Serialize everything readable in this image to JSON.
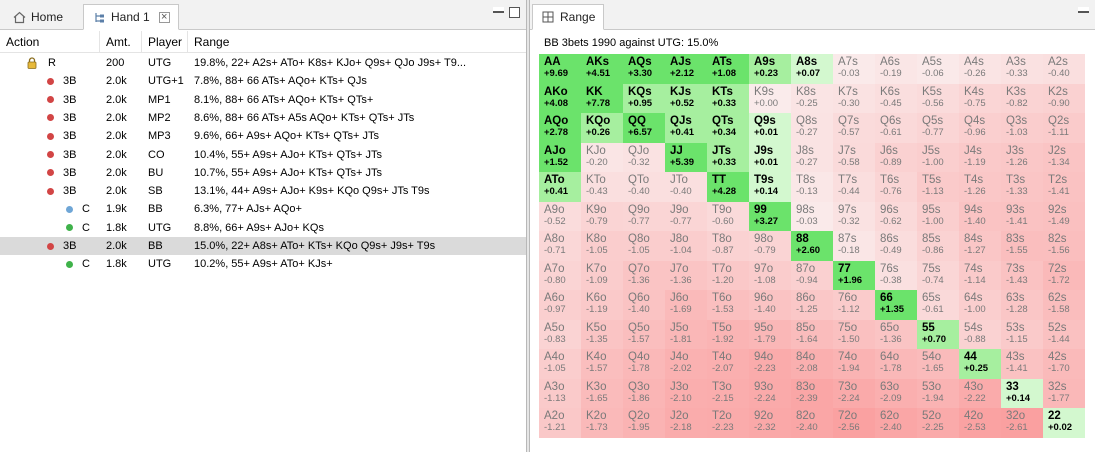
{
  "left": {
    "tabs": [
      {
        "label": "Home"
      },
      {
        "label": "Hand 1"
      }
    ],
    "columns": [
      "Action",
      "Amt.",
      "Player",
      "Range"
    ],
    "rows": [
      {
        "action": "R",
        "amt": "200",
        "player": "UTG",
        "range": "19.8%, 22+ A2s+ ATo+ K8s+ KJo+ Q9s+ QJo J9s+ T9...",
        "dot": "lock",
        "indent": 0
      },
      {
        "action": "3B",
        "amt": "2.0k",
        "player": "UTG+1",
        "range": "7.8%, 88+ 66 ATs+ AQo+ KTs+ QJs",
        "dot": "red",
        "indent": 1
      },
      {
        "action": "3B",
        "amt": "2.0k",
        "player": "MP1",
        "range": "8.1%, 88+ 66 ATs+ AQo+ KTs+ QTs+",
        "dot": "red",
        "indent": 1
      },
      {
        "action": "3B",
        "amt": "2.0k",
        "player": "MP2",
        "range": "8.6%, 88+ 66 ATs+ A5s AQo+ KTs+ QTs+ JTs",
        "dot": "red",
        "indent": 1
      },
      {
        "action": "3B",
        "amt": "2.0k",
        "player": "MP3",
        "range": "9.6%, 66+ A9s+ AQo+ KTs+ QTs+ JTs",
        "dot": "red",
        "indent": 1
      },
      {
        "action": "3B",
        "amt": "2.0k",
        "player": "CO",
        "range": "10.4%, 55+ A9s+ AJo+ KTs+ QTs+ JTs",
        "dot": "red",
        "indent": 1
      },
      {
        "action": "3B",
        "amt": "2.0k",
        "player": "BU",
        "range": "10.7%, 55+ A9s+ AJo+ KTs+ QTs+ JTs",
        "dot": "red",
        "indent": 1
      },
      {
        "action": "3B",
        "amt": "2.0k",
        "player": "SB",
        "range": "13.1%, 44+ A9s+ AJo+ K9s+ KQo Q9s+ JTs T9s",
        "dot": "red",
        "indent": 1
      },
      {
        "action": "C",
        "amt": "1.9k",
        "player": "BB",
        "range": "6.3%, 77+ AJs+ AQo+",
        "dot": "blue",
        "indent": 2
      },
      {
        "action": "C",
        "amt": "1.8k",
        "player": "UTG",
        "range": "8.8%, 66+ A9s+ AJo+ KQs",
        "dot": "green",
        "indent": 2
      },
      {
        "action": "3B",
        "amt": "2.0k",
        "player": "BB",
        "range": "15.0%, 22+ A8s+ ATo+ KTs+ KQo Q9s+ J9s+ T9s",
        "dot": "red",
        "indent": 1
      },
      {
        "action": "C",
        "amt": "1.8k",
        "player": "UTG",
        "range": "10.2%, 55+ A9s+ ATo+ KJs+",
        "dot": "green",
        "indent": 2
      }
    ]
  },
  "right": {
    "tab": "Range",
    "title": "BB 3bets 1990 against UTG: 15.0%",
    "colors": {
      "green_strong": "#6be36b",
      "green_light": "#c8f5c8",
      "white": "#ffffff",
      "red": "#f5b5b5"
    },
    "matrix": [
      [
        [
          "AA",
          "+9.69"
        ],
        [
          "AKs",
          "+4.51"
        ],
        [
          "AQs",
          "+3.30"
        ],
        [
          "AJs",
          "+2.12"
        ],
        [
          "ATs",
          "+1.08"
        ],
        [
          "A9s",
          "+0.23"
        ],
        [
          "A8s",
          "+0.07"
        ],
        [
          "A7s",
          "-0.03"
        ],
        [
          "A6s",
          "-0.19"
        ],
        [
          "A5s",
          "-0.06"
        ],
        [
          "A4s",
          "-0.26"
        ],
        [
          "A3s",
          "-0.33"
        ],
        [
          "A2s",
          "-0.40"
        ]
      ],
      [
        [
          "AKo",
          "+4.08"
        ],
        [
          "KK",
          "+7.78"
        ],
        [
          "KQs",
          "+0.95"
        ],
        [
          "KJs",
          "+0.52"
        ],
        [
          "KTs",
          "+0.33"
        ],
        [
          "K9s",
          "+0.00"
        ],
        [
          "K8s",
          "-0.25"
        ],
        [
          "K7s",
          "-0.30"
        ],
        [
          "K6s",
          "-0.45"
        ],
        [
          "K5s",
          "-0.56"
        ],
        [
          "K4s",
          "-0.75"
        ],
        [
          "K3s",
          "-0.82"
        ],
        [
          "K2s",
          "-0.90"
        ]
      ],
      [
        [
          "AQo",
          "+2.78"
        ],
        [
          "KQo",
          "+0.26"
        ],
        [
          "QQ",
          "+6.57"
        ],
        [
          "QJs",
          "+0.41"
        ],
        [
          "QTs",
          "+0.34"
        ],
        [
          "Q9s",
          "+0.01"
        ],
        [
          "Q8s",
          "-0.27"
        ],
        [
          "Q7s",
          "-0.57"
        ],
        [
          "Q6s",
          "-0.61"
        ],
        [
          "Q5s",
          "-0.77"
        ],
        [
          "Q4s",
          "-0.96"
        ],
        [
          "Q3s",
          "-1.03"
        ],
        [
          "Q2s",
          "-1.11"
        ]
      ],
      [
        [
          "AJo",
          "+1.52"
        ],
        [
          "KJo",
          "-0.20"
        ],
        [
          "QJo",
          "-0.32"
        ],
        [
          "JJ",
          "+5.39"
        ],
        [
          "JTs",
          "+0.33"
        ],
        [
          "J9s",
          "+0.01"
        ],
        [
          "J8s",
          "-0.27"
        ],
        [
          "J7s",
          "-0.58"
        ],
        [
          "J6s",
          "-0.89"
        ],
        [
          "J5s",
          "-1.00"
        ],
        [
          "J4s",
          "-1.19"
        ],
        [
          "J3s",
          "-1.26"
        ],
        [
          "J2s",
          "-1.34"
        ]
      ],
      [
        [
          "ATo",
          "+0.41"
        ],
        [
          "KTo",
          "-0.43"
        ],
        [
          "QTo",
          "-0.40"
        ],
        [
          "JTo",
          "-0.40"
        ],
        [
          "TT",
          "+4.28"
        ],
        [
          "T9s",
          "+0.14"
        ],
        [
          "T8s",
          "-0.13"
        ],
        [
          "T7s",
          "-0.44"
        ],
        [
          "T6s",
          "-0.76"
        ],
        [
          "T5s",
          "-1.13"
        ],
        [
          "T4s",
          "-1.26"
        ],
        [
          "T3s",
          "-1.33"
        ],
        [
          "T2s",
          "-1.41"
        ]
      ],
      [
        [
          "A9o",
          "-0.52"
        ],
        [
          "K9o",
          "-0.79"
        ],
        [
          "Q9o",
          "-0.77"
        ],
        [
          "J9o",
          "-0.77"
        ],
        [
          "T9o",
          "-0.60"
        ],
        [
          "99",
          "+3.27"
        ],
        [
          "98s",
          "-0.03"
        ],
        [
          "97s",
          "-0.32"
        ],
        [
          "96s",
          "-0.62"
        ],
        [
          "95s",
          "-1.00"
        ],
        [
          "94s",
          "-1.40"
        ],
        [
          "93s",
          "-1.41"
        ],
        [
          "92s",
          "-1.49"
        ]
      ],
      [
        [
          "A8o",
          "-0.71"
        ],
        [
          "K8o",
          "-1.05"
        ],
        [
          "Q8o",
          "-1.05"
        ],
        [
          "J8o",
          "-1.04"
        ],
        [
          "T8o",
          "-0.87"
        ],
        [
          "98o",
          "-0.79"
        ],
        [
          "88",
          "+2.60"
        ],
        [
          "87s",
          "-0.18"
        ],
        [
          "86s",
          "-0.49"
        ],
        [
          "85s",
          "-0.86"
        ],
        [
          "84s",
          "-1.27"
        ],
        [
          "83s",
          "-1.55"
        ],
        [
          "82s",
          "-1.56"
        ]
      ],
      [
        [
          "A7o",
          "-0.80"
        ],
        [
          "K7o",
          "-1.09"
        ],
        [
          "Q7o",
          "-1.36"
        ],
        [
          "J7o",
          "-1.36"
        ],
        [
          "T7o",
          "-1.20"
        ],
        [
          "97o",
          "-1.08"
        ],
        [
          "87o",
          "-0.94"
        ],
        [
          "77",
          "+1.96"
        ],
        [
          "76s",
          "-0.38"
        ],
        [
          "75s",
          "-0.74"
        ],
        [
          "74s",
          "-1.14"
        ],
        [
          "73s",
          "-1.43"
        ],
        [
          "72s",
          "-1.72"
        ]
      ],
      [
        [
          "A6o",
          "-0.97"
        ],
        [
          "K6o",
          "-1.19"
        ],
        [
          "Q6o",
          "-1.40"
        ],
        [
          "J6o",
          "-1.69"
        ],
        [
          "T6o",
          "-1.53"
        ],
        [
          "96o",
          "-1.40"
        ],
        [
          "86o",
          "-1.25"
        ],
        [
          "76o",
          "-1.12"
        ],
        [
          "66",
          "+1.35"
        ],
        [
          "65s",
          "-0.61"
        ],
        [
          "64s",
          "-1.00"
        ],
        [
          "63s",
          "-1.28"
        ],
        [
          "62s",
          "-1.58"
        ]
      ],
      [
        [
          "A5o",
          "-0.83"
        ],
        [
          "K5o",
          "-1.35"
        ],
        [
          "Q5o",
          "-1.57"
        ],
        [
          "J5o",
          "-1.81"
        ],
        [
          "T5o",
          "-1.92"
        ],
        [
          "95o",
          "-1.79"
        ],
        [
          "85o",
          "-1.64"
        ],
        [
          "75o",
          "-1.50"
        ],
        [
          "65o",
          "-1.36"
        ],
        [
          "55",
          "+0.70"
        ],
        [
          "54s",
          "-0.88"
        ],
        [
          "53s",
          "-1.15"
        ],
        [
          "52s",
          "-1.44"
        ]
      ],
      [
        [
          "A4o",
          "-1.05"
        ],
        [
          "K4o",
          "-1.57"
        ],
        [
          "Q4o",
          "-1.78"
        ],
        [
          "J4o",
          "-2.02"
        ],
        [
          "T4o",
          "-2.07"
        ],
        [
          "94o",
          "-2.23"
        ],
        [
          "84o",
          "-2.08"
        ],
        [
          "74o",
          "-1.94"
        ],
        [
          "64o",
          "-1.78"
        ],
        [
          "54o",
          "-1.65"
        ],
        [
          "44",
          "+0.25"
        ],
        [
          "43s",
          "-1.41"
        ],
        [
          "42s",
          "-1.70"
        ]
      ],
      [
        [
          "A3o",
          "-1.13"
        ],
        [
          "K3o",
          "-1.65"
        ],
        [
          "Q3o",
          "-1.86"
        ],
        [
          "J3o",
          "-2.10"
        ],
        [
          "T3o",
          "-2.15"
        ],
        [
          "93o",
          "-2.24"
        ],
        [
          "83o",
          "-2.39"
        ],
        [
          "73o",
          "-2.24"
        ],
        [
          "63o",
          "-2.09"
        ],
        [
          "53o",
          "-1.94"
        ],
        [
          "43o",
          "-2.22"
        ],
        [
          "33",
          "+0.14"
        ],
        [
          "32s",
          "-1.77"
        ]
      ],
      [
        [
          "A2o",
          "-1.21"
        ],
        [
          "K2o",
          "-1.73"
        ],
        [
          "Q2o",
          "-1.95"
        ],
        [
          "J2o",
          "-2.18"
        ],
        [
          "T2o",
          "-2.23"
        ],
        [
          "92o",
          "-2.32"
        ],
        [
          "82o",
          "-2.40"
        ],
        [
          "72o",
          "-2.56"
        ],
        [
          "62o",
          "-2.40"
        ],
        [
          "52o",
          "-2.25"
        ],
        [
          "42o",
          "-2.53"
        ],
        [
          "32o",
          "-2.61"
        ],
        [
          "22",
          "+0.02"
        ]
      ]
    ],
    "in_range": [
      "AA",
      "AKs",
      "AQs",
      "AJs",
      "ATs",
      "A9s",
      "A8s",
      "AKo",
      "KK",
      "KQs",
      "KJs",
      "KTs",
      "AQo",
      "KQo",
      "QQ",
      "QJs",
      "QTs",
      "Q9s",
      "AJo",
      "JJ",
      "JTs",
      "J9s",
      "ATo",
      "TT",
      "T9s",
      "99",
      "88",
      "77",
      "66",
      "55",
      "44",
      "33",
      "22"
    ]
  }
}
